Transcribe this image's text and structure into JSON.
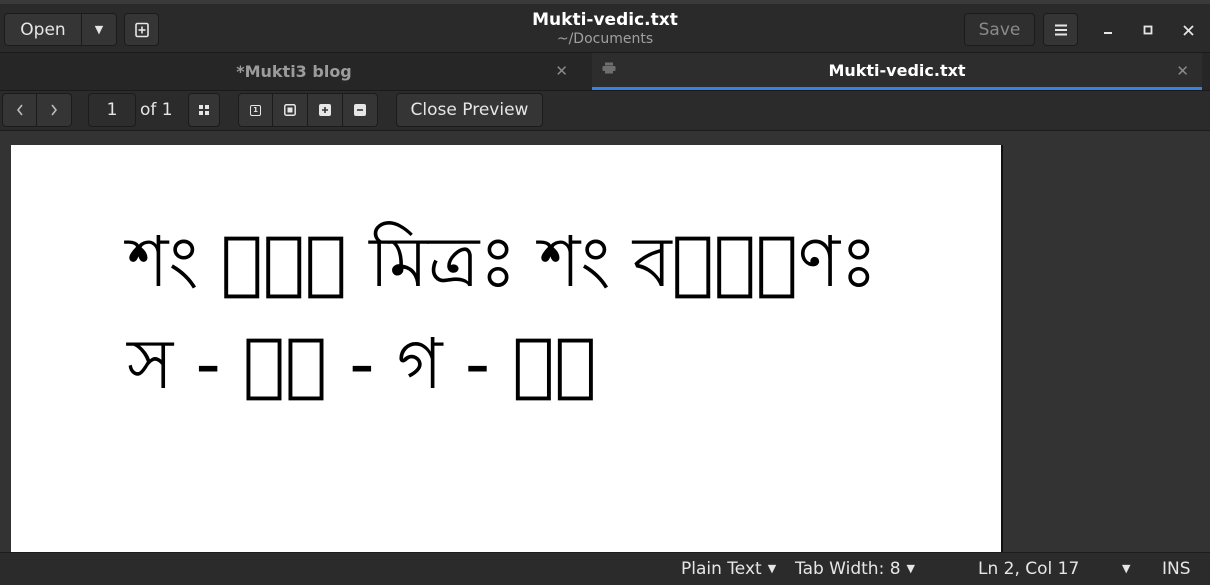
{
  "header": {
    "open_label": "Open",
    "title": "Mukti-vedic.txt",
    "subtitle": "~/Documents",
    "save_label": "Save"
  },
  "tabs": [
    {
      "label": "*Mukti3 blog",
      "active": false
    },
    {
      "label": "Mukti-vedic.txt",
      "active": true
    }
  ],
  "preview": {
    "page_number": "1",
    "page_count_label": "of 1",
    "close_preview_label": "Close Preview"
  },
  "document": {
    "lines": [
      "শং নো॑ মিত্রঃ শং বরু॑ণঃ",
      "স - র॒ - গ - ম॑"
    ]
  },
  "statusbar": {
    "syntax": "Plain Text",
    "tab_width": "Tab Width: 8",
    "position": "Ln 2, Col 17",
    "mode": "INS"
  },
  "colors": {
    "accent": "#3584e4",
    "background": "#2b2b2b",
    "page": "#ffffff"
  }
}
